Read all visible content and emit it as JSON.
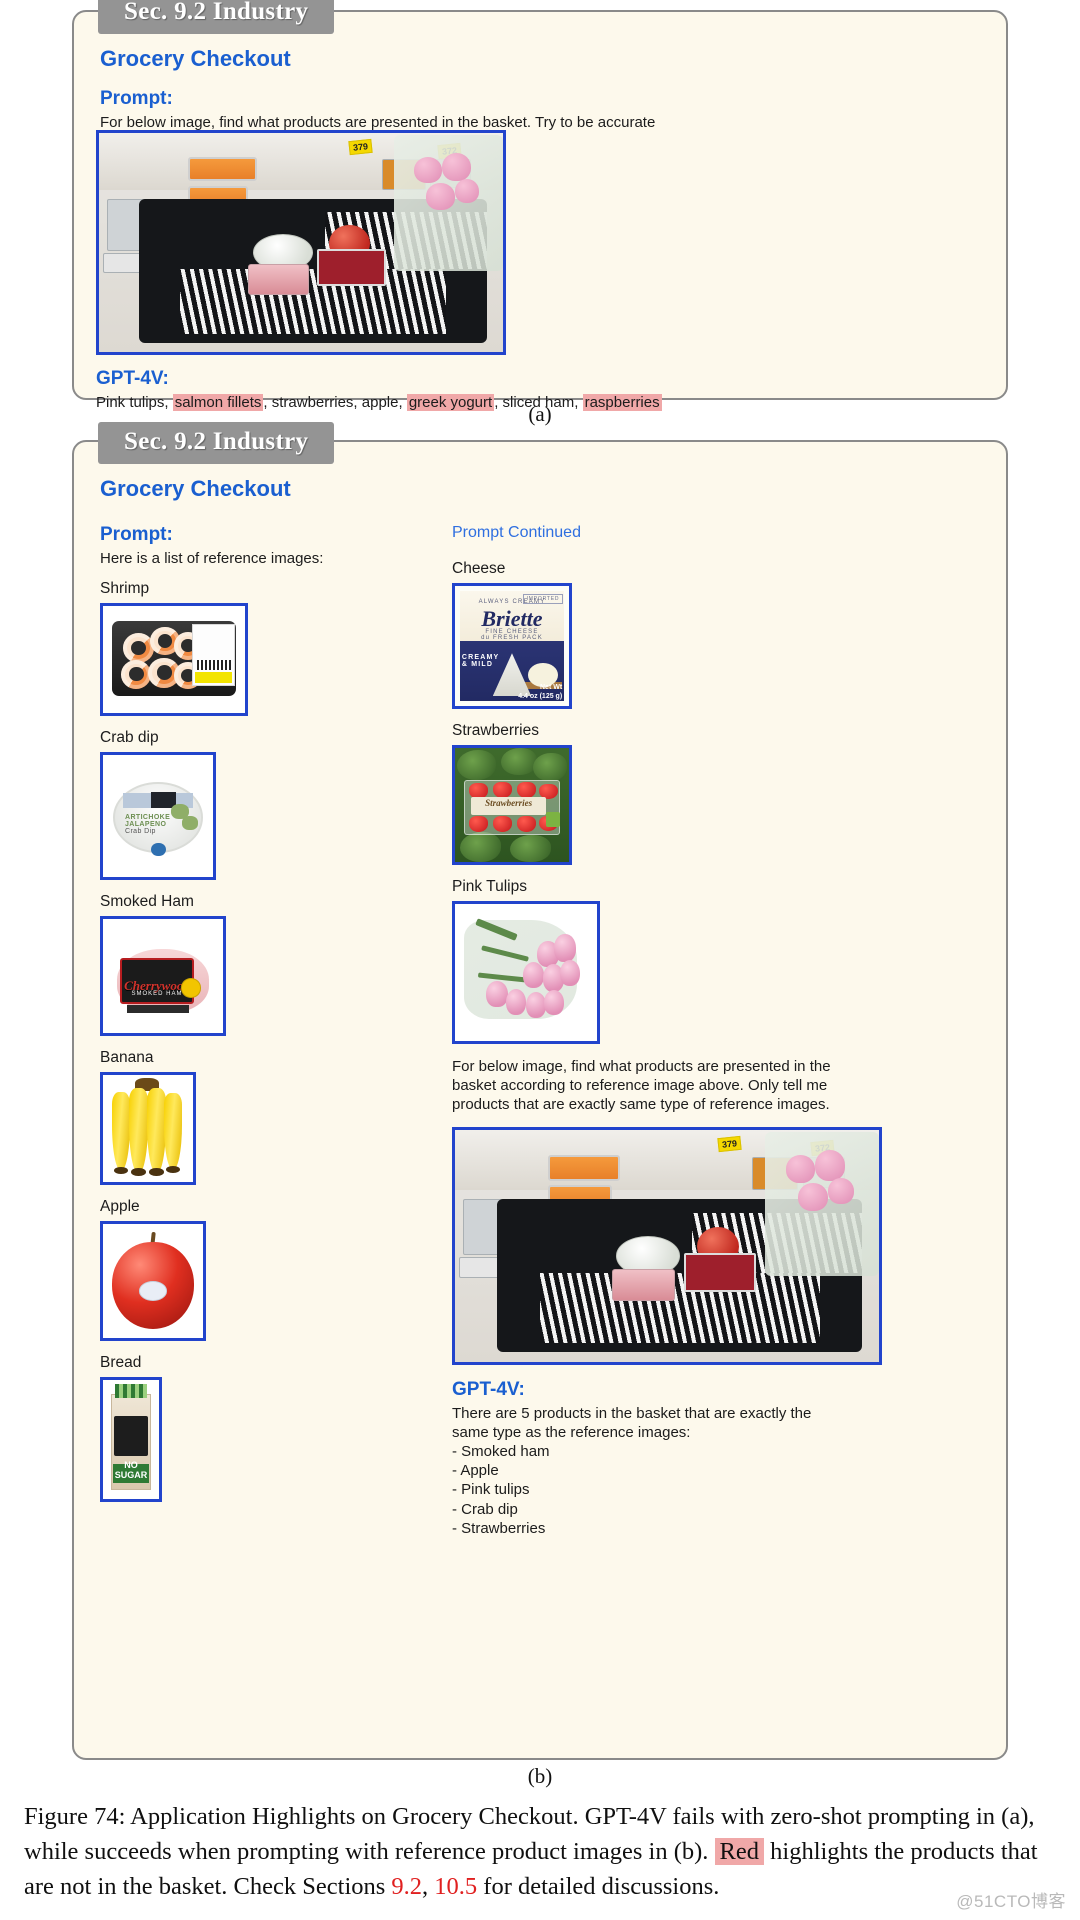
{
  "panel_a": {
    "tab": "Sec. 9.2 Industry",
    "section_title": "Grocery Checkout",
    "prompt_label": "Prompt:",
    "prompt_text": "For below image, find what products are presented in the basket. Try to be accurate",
    "gpt_label": "GPT-4V:",
    "answer_parts": [
      {
        "text": "Pink tulips, ",
        "highlight": false
      },
      {
        "text": "salmon fillets",
        "highlight": true
      },
      {
        "text": ", strawberries, apple, ",
        "highlight": false
      },
      {
        "text": "greek yogurt",
        "highlight": true
      },
      {
        "text": ", sliced ham, ",
        "highlight": false
      },
      {
        "text": "raspberries",
        "highlight": true
      }
    ],
    "figure_letter": "(a)",
    "basket_price_tags": [
      "379",
      "372"
    ]
  },
  "panel_b": {
    "tab": "Sec. 9.2 Industry",
    "section_title": "Grocery Checkout",
    "prompt_label": "Prompt:",
    "prompt_text": "Here is a list of reference images:",
    "prompt_continued_label": "Prompt Continued",
    "reference_images_left": [
      {
        "label": "Shrimp"
      },
      {
        "label": "Crab dip"
      },
      {
        "label": "Smoked Ham"
      },
      {
        "label": "Banana"
      },
      {
        "label": "Apple"
      },
      {
        "label": "Bread"
      }
    ],
    "reference_images_right": [
      {
        "label": "Cheese"
      },
      {
        "label": "Strawberries"
      },
      {
        "label": "Pink Tulips"
      }
    ],
    "instruction_text": "For below image, find what products are presented in the basket according to reference image above. Only tell me products that are exactly same type of reference images.",
    "gpt_label": "GPT-4V:",
    "answer_intro": "There are 5 products in the basket that are exactly the same type as the reference images:",
    "answer_items": [
      "- Smoked ham",
      "- Apple",
      "- Pink tulips",
      "- Crab dip",
      "- Strawberries"
    ],
    "figure_letter": "(b)",
    "crab_dip_art": {
      "line1": "ARTICHOKE",
      "line2": "JALAPENO",
      "line3": "Crab Dip"
    },
    "ham_art": {
      "brand": "Cherrywood",
      "sub": "SMOKED   HAM"
    },
    "cheese_art": {
      "imported": "IMPORTED",
      "tagline": "ALWAYS CREAMY",
      "brand": "Briette",
      "sub1": "FINE CHEESE",
      "sub2": "du FRESH PACK",
      "variant": "CREAMY & MILD",
      "net_label": "Net Wt",
      "net_value": "4.4 oz (125 g)"
    },
    "strawberry_art": {
      "label": "Strawberries"
    },
    "bread_art": {
      "band": "NO SUGAR"
    }
  },
  "caption": {
    "text_1": "Figure 74: Application Highlights on Grocery Checkout. GPT-4V fails with zero-shot prompting in (a), while succeeds when prompting with reference product images in (b). ",
    "red_word": "Red",
    "text_2": " highlights the products that are not in the basket. Check Sections ",
    "sec_1": "9.2",
    "sep": ", ",
    "sec_2": "10.5",
    "text_3": " for detailed discussions."
  },
  "watermark": "@51CTO博客",
  "colors": {
    "accent_blue": "#1a5fd0",
    "highlight_red": "#f0a8a8",
    "section_red": "#e02020",
    "panel_bg": "#fdf9ec",
    "tab_gray": "#949494",
    "image_border": "#2244cc"
  }
}
